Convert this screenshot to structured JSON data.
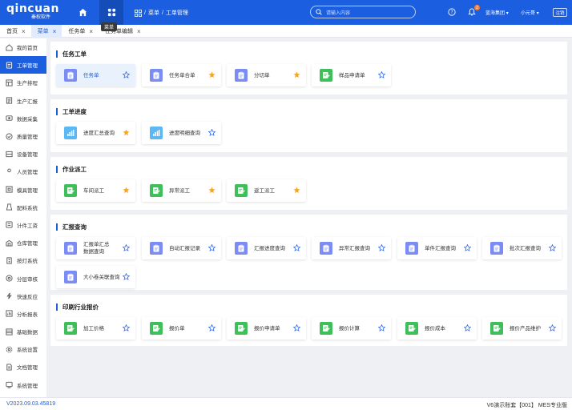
{
  "header": {
    "logo_text": "qincuan",
    "logo_sub": "秦权软件",
    "home_icon": "home-icon",
    "menu_icon": "grid-icon",
    "tooltip": "菜单",
    "breadcrumb": [
      "菜单",
      "工单管理"
    ],
    "search_placeholder": "请输入内容",
    "notification_count": "2",
    "company": "蓝海集团",
    "user": "小元哥",
    "logout": "注销",
    "brand_color": "#1b5ee0"
  },
  "tabs": [
    {
      "label": "首页"
    },
    {
      "label": "菜单"
    },
    {
      "label": "任务单"
    },
    {
      "label": "任务单编辑"
    }
  ],
  "sidebar": {
    "items": [
      {
        "label": "我的首页",
        "icon": "home-icon"
      },
      {
        "label": "工单管理",
        "icon": "order-icon"
      },
      {
        "label": "生产排程",
        "icon": "schedule-icon"
      },
      {
        "label": "生产汇报",
        "icon": "report-icon"
      },
      {
        "label": "数据采集",
        "icon": "collect-icon"
      },
      {
        "label": "质量管理",
        "icon": "quality-icon"
      },
      {
        "label": "设备管理",
        "icon": "device-icon"
      },
      {
        "label": "人员管理",
        "icon": "people-icon"
      },
      {
        "label": "模具管理",
        "icon": "mold-icon"
      },
      {
        "label": "配料系统",
        "icon": "ingredient-icon"
      },
      {
        "label": "计件工资",
        "icon": "wage-icon"
      },
      {
        "label": "仓库管理",
        "icon": "warehouse-icon"
      },
      {
        "label": "按灯系统",
        "icon": "andon-icon"
      },
      {
        "label": "分层审核",
        "icon": "audit-icon"
      },
      {
        "label": "快速反应",
        "icon": "flash-icon"
      },
      {
        "label": "分析报表",
        "icon": "chart-icon"
      },
      {
        "label": "基础数据",
        "icon": "database-icon"
      },
      {
        "label": "系统设置",
        "icon": "settings-icon"
      },
      {
        "label": "文档管理",
        "icon": "document-icon"
      },
      {
        "label": "系统管理",
        "icon": "system-icon"
      }
    ]
  },
  "sections": [
    {
      "title": "任务工单",
      "cards": [
        {
          "label": "任务单",
          "icon": "clipboard-icon",
          "color": "#7b8cf5",
          "starred": false
        },
        {
          "label": "任务单合单",
          "icon": "clipboard-icon",
          "color": "#7b8cf5",
          "starred": true
        },
        {
          "label": "分切单",
          "icon": "clipboard-icon",
          "color": "#7b8cf5",
          "starred": true
        },
        {
          "label": "样品申请单",
          "icon": "edit-doc-icon",
          "color": "#3fbf5a",
          "starred": false
        }
      ]
    },
    {
      "title": "工单进度",
      "cards": [
        {
          "label": "进度汇总查询",
          "icon": "bar-chart-icon",
          "color": "#5bb8f5",
          "starred": true
        },
        {
          "label": "进度明细查询",
          "icon": "bar-chart-icon",
          "color": "#5bb8f5",
          "starred": false
        }
      ]
    },
    {
      "title": "作业派工",
      "cards": [
        {
          "label": "车间派工",
          "icon": "edit-doc-icon",
          "color": "#3fbf5a",
          "starred": true
        },
        {
          "label": "异常派工",
          "icon": "edit-doc-icon",
          "color": "#3fbf5a",
          "starred": true
        },
        {
          "label": "返工派工",
          "icon": "edit-doc-icon",
          "color": "#3fbf5a",
          "starred": true
        }
      ]
    },
    {
      "title": "汇报查询",
      "cards": [
        {
          "label": "汇报单汇总\n数据查询",
          "icon": "clipboard-icon",
          "color": "#7b8cf5",
          "starred": false
        },
        {
          "label": "自动汇报记录",
          "icon": "clipboard-icon",
          "color": "#7b8cf5",
          "starred": false
        },
        {
          "label": "汇报进度查询",
          "icon": "clipboard-icon",
          "color": "#7b8cf5",
          "starred": false
        },
        {
          "label": "异常汇报查询",
          "icon": "clipboard-icon",
          "color": "#7b8cf5",
          "starred": false
        },
        {
          "label": "单件汇报查询",
          "icon": "clipboard-icon",
          "color": "#7b8cf5",
          "starred": false
        },
        {
          "label": "批次汇报查询",
          "icon": "clipboard-icon",
          "color": "#7b8cf5",
          "starred": false
        },
        {
          "label": "大小卷关联查询",
          "icon": "clipboard-icon",
          "color": "#7b8cf5",
          "starred": false
        }
      ]
    },
    {
      "title": "印刷行业报价",
      "cards": [
        {
          "label": "加工价格",
          "icon": "edit-doc-icon",
          "color": "#3fbf5a",
          "starred": false
        },
        {
          "label": "报价单",
          "icon": "edit-doc-icon",
          "color": "#3fbf5a",
          "starred": false
        },
        {
          "label": "报价申请单",
          "icon": "edit-doc-icon",
          "color": "#3fbf5a",
          "starred": false
        },
        {
          "label": "报价计算",
          "icon": "edit-doc-icon",
          "color": "#3fbf5a",
          "starred": false
        },
        {
          "label": "报价成本",
          "icon": "edit-doc-icon",
          "color": "#3fbf5a",
          "starred": false
        },
        {
          "label": "报价产品维护",
          "icon": "edit-doc-icon",
          "color": "#3fbf5a",
          "starred": false
        }
      ]
    }
  ],
  "footer": {
    "version": "V2023.09.03.45819",
    "account": "V6演示账套【001】 MES专业版"
  }
}
